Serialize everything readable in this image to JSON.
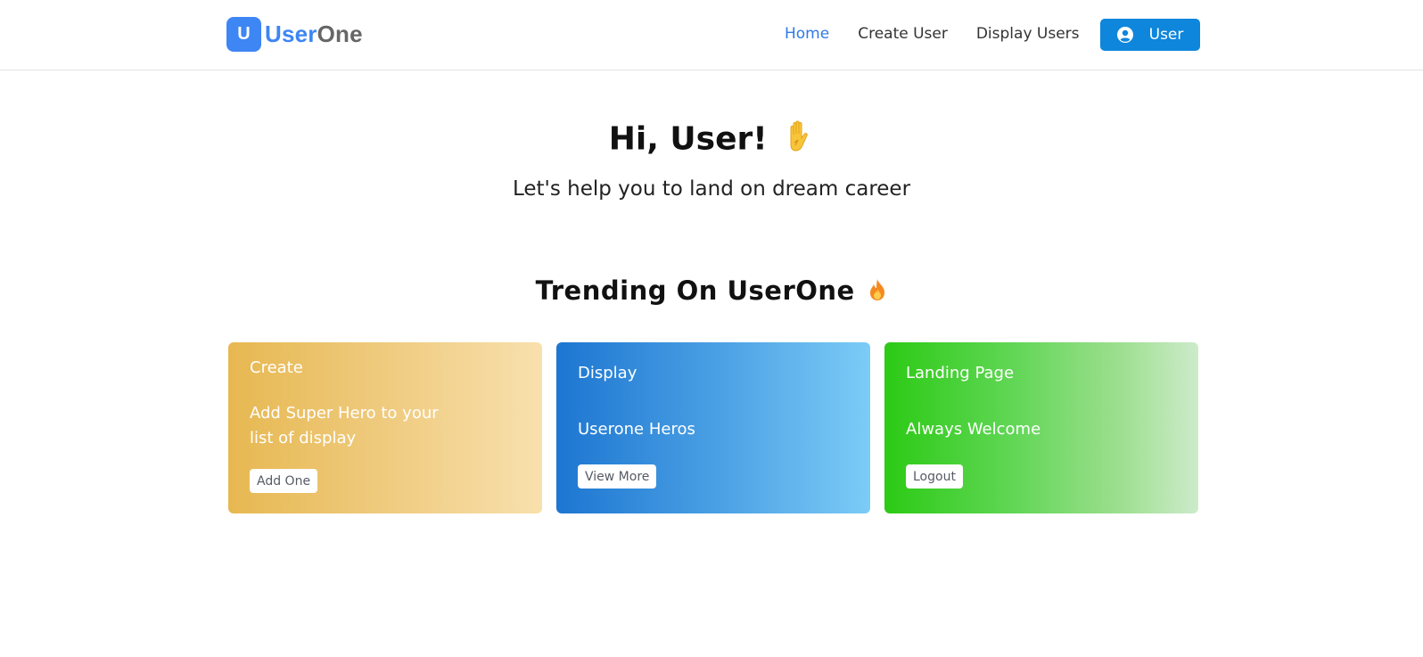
{
  "nav": {
    "brand_badge": "U",
    "brand_part1": "User",
    "brand_part2": "One",
    "links": [
      {
        "label": "Home",
        "active": true
      },
      {
        "label": "Create User",
        "active": false
      },
      {
        "label": "Display Users",
        "active": false
      }
    ],
    "user_button": {
      "label": "User",
      "icon": "user-circle-icon"
    }
  },
  "hero": {
    "title": "Hi, User!",
    "title_icon": "raised-hand-icon",
    "subtitle": "Let's help you to land on dream career"
  },
  "trending": {
    "title": "Trending On UserOne",
    "title_icon": "fire-icon",
    "cards": [
      {
        "title": "Create",
        "text": "Add Super Hero to your list of display",
        "button": "Add One"
      },
      {
        "title": "Display",
        "text": "Userone Heros",
        "button": "View More"
      },
      {
        "title": "Landing Page",
        "text": "Always Welcome",
        "button": "Logout"
      }
    ]
  },
  "colors": {
    "primary": "#3d86f4",
    "user_button_bg": "#0e86dc",
    "nav_active": "#2f79e6",
    "brand_gray": "#666666"
  }
}
